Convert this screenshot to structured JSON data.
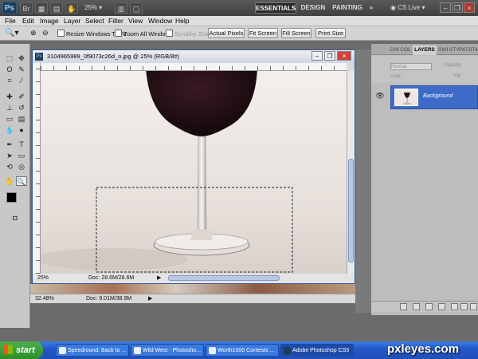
{
  "app": {
    "logo": "Ps",
    "zoom": "25%",
    "workspaces": [
      "ESSENTIALS",
      "DESIGN",
      "PAINTING"
    ],
    "more": "»",
    "cs_live": "CS Live"
  },
  "menu": [
    "File",
    "Edit",
    "Image",
    "Layer",
    "Select",
    "Filter",
    "View",
    "Window",
    "Help"
  ],
  "options": {
    "resize_windows": "Resize Windows To Fit",
    "zoom_all": "Zoom All Windows",
    "scrubby": "Scrubby Zoom",
    "actual_pixels": "Actual Pixels",
    "fit_screen": "Fit Screen",
    "fill_screen": "Fill Screen",
    "print_size": "Print Size"
  },
  "document": {
    "title": "3104965989_0f9073c26d_o.jpg @ 25% (RGB/8#)",
    "zoom": "25%",
    "doc_size": "Doc: 28.6M/28.6M"
  },
  "status": {
    "zoom": "32.48%",
    "doc_size": "Doc: 9.01M/38.9M"
  },
  "panel": {
    "tabs": [
      "CHI",
      "COL",
      "LAYERS",
      "SWI",
      "STY",
      "PAT",
      "STA"
    ],
    "blend_mode": "Normal",
    "opacity_label": "Opacity:",
    "lock_label": "Lock:",
    "fill_label": "Fill:",
    "layer_name": "Background"
  },
  "taskbar": {
    "start": "start",
    "tasks": [
      "Speedround: Back to ...",
      "Wild West - Photosho...",
      "Worth1000 Contests ...",
      "Adobe Photoshop CS5"
    ]
  },
  "watermark": "pxleyes.com",
  "colors": {
    "layer_selected": "#3d6bc7",
    "taskbar": "#2459c9"
  }
}
